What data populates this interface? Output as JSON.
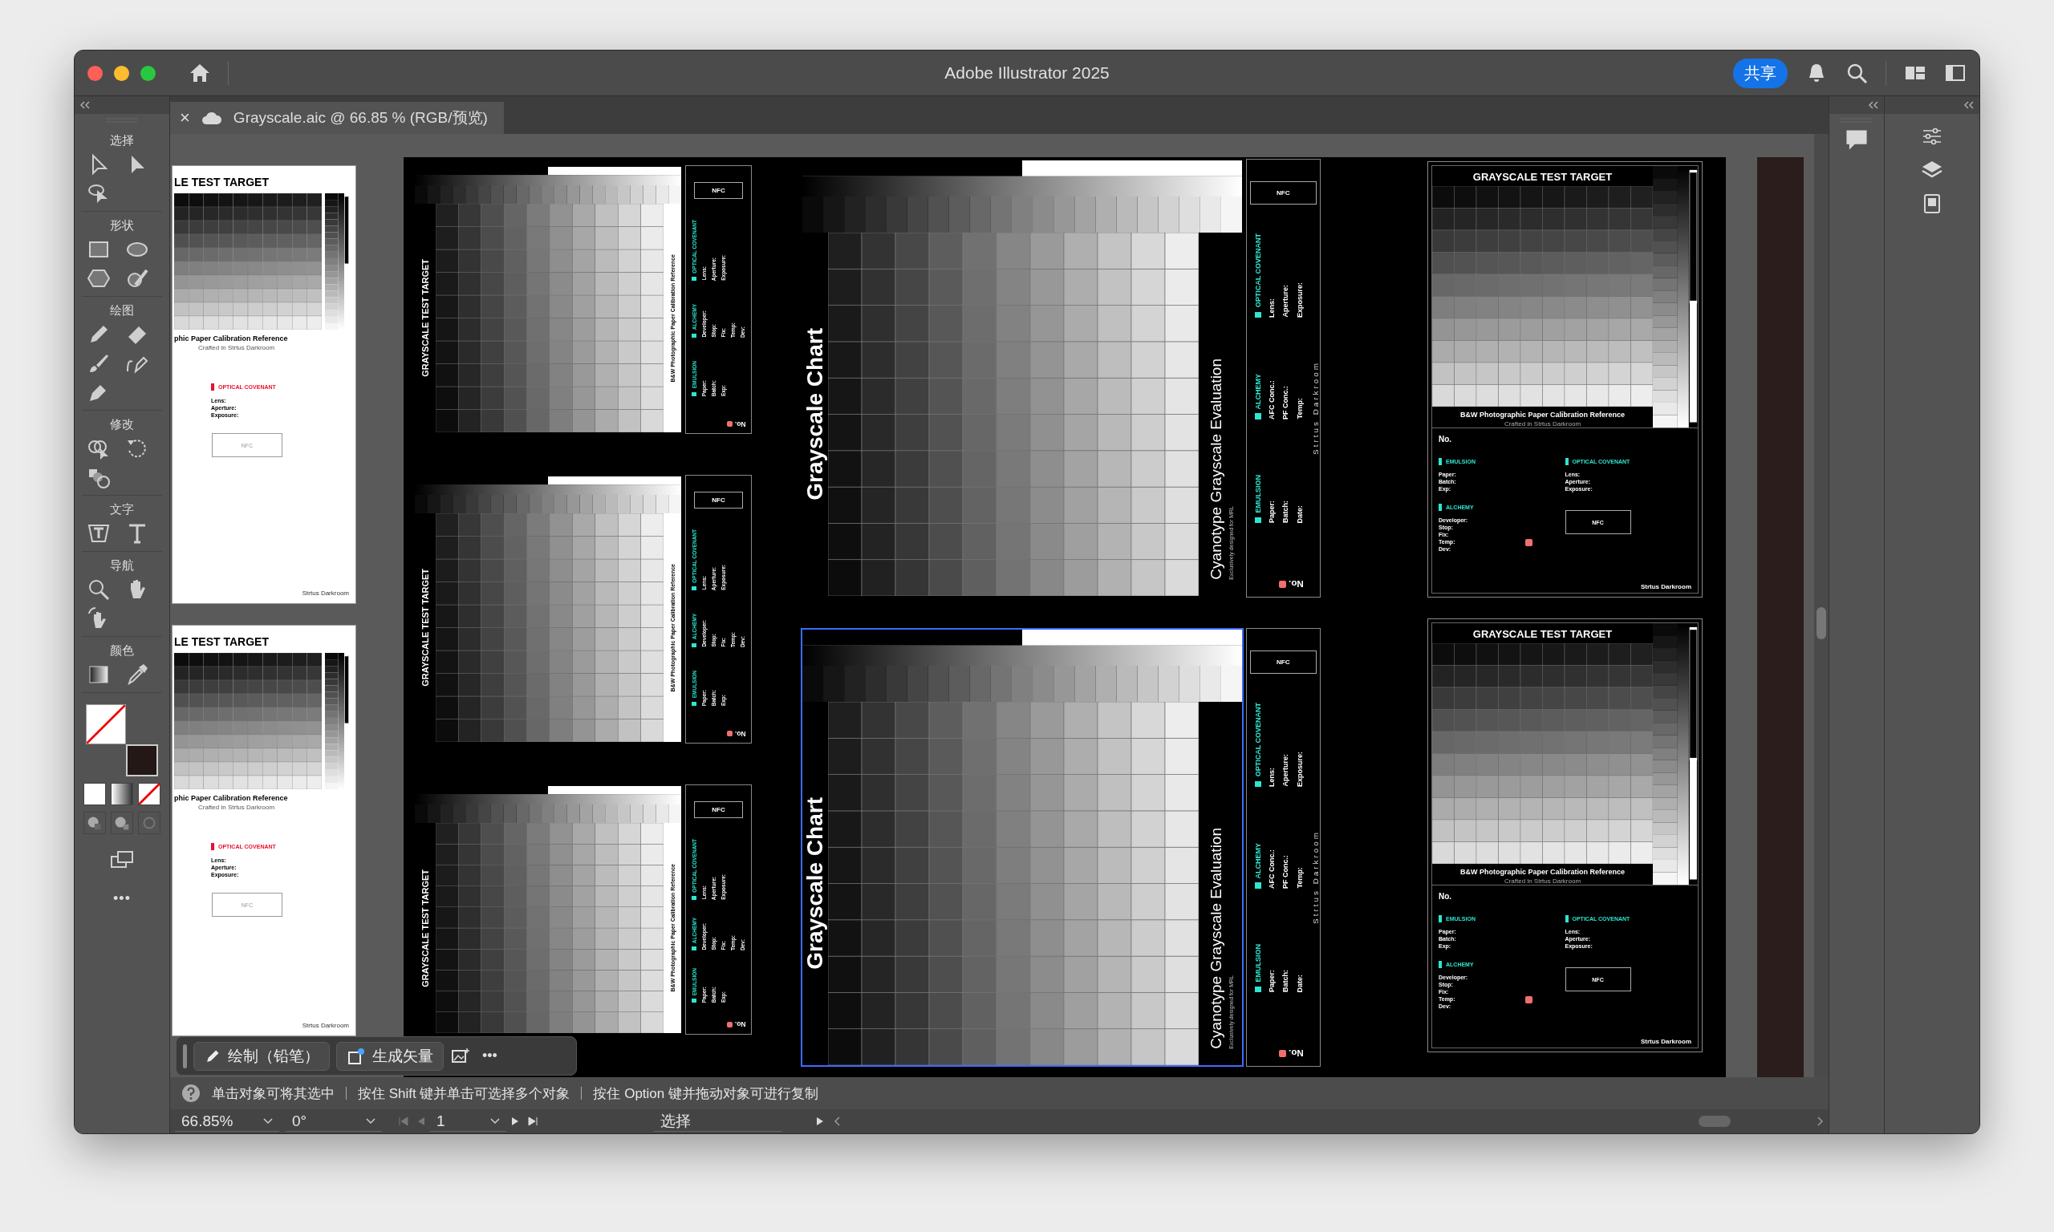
{
  "app": {
    "title": "Adobe Illustrator 2025",
    "share": "共享"
  },
  "document_tab": {
    "close": "×",
    "title": "Grayscale.aic @ 66.85 % (RGB/预览)"
  },
  "toolbar": {
    "groups": [
      {
        "label": "选择",
        "tools": [
          {
            "kind": "direct"
          },
          {
            "kind": "select"
          },
          {
            "kind": "lasso"
          }
        ]
      },
      {
        "label": "形状",
        "tools": [
          {
            "kind": "rect"
          },
          {
            "kind": "ellipse"
          },
          {
            "kind": "hexagon"
          },
          {
            "kind": "shaper"
          }
        ]
      },
      {
        "label": "绘图",
        "tools": [
          {
            "kind": "pencil"
          },
          {
            "kind": "eraser"
          },
          {
            "kind": "brush"
          },
          {
            "kind": "curvature"
          },
          {
            "kind": "pen"
          }
        ]
      },
      {
        "label": "修改",
        "tools": [
          {
            "kind": "builder"
          },
          {
            "kind": "rotate"
          },
          {
            "kind": "blend"
          }
        ]
      },
      {
        "label": "文字",
        "tools": [
          {
            "kind": "touchtype"
          },
          {
            "kind": "type"
          }
        ]
      },
      {
        "label": "导航",
        "tools": [
          {
            "kind": "zoom"
          },
          {
            "kind": "hand"
          },
          {
            "kind": "rotateview"
          }
        ]
      },
      {
        "label": "颜色",
        "tools": [
          {
            "kind": "gradient"
          },
          {
            "kind": "eyedropper"
          }
        ]
      }
    ],
    "more": "•••"
  },
  "canvas": {
    "page_boards": [
      {
        "title": "LE TEST TARGET",
        "subtitle": "phic Paper Calibration Reference",
        "credit_line": "Crafted in Strtus Darkroom",
        "section": "OPTICAL COVENANT",
        "fields": [
          "Lens:",
          "Aperture:",
          "Exposure:"
        ],
        "nfc": "NFC",
        "credit": "Strtus Darkroom"
      },
      {
        "title": "LE TEST TARGET",
        "subtitle": "phic Paper Calibration Reference",
        "credit_line": "Crafted in Strtus Darkroom",
        "section": "OPTICAL COVENANT",
        "fields": [
          "Lens:",
          "Aperture:",
          "Exposure:"
        ],
        "nfc": "NFC",
        "credit": "Strtus Darkroom"
      }
    ],
    "strip_boards": [
      {
        "title": "GRAYSCALE TEST TARGET",
        "subtitle": "B&W Photographic Paper Calibration Reference",
        "panel": {
          "nfc": "NFC",
          "sections": [
            {
              "name": "OPTICAL COVENANT",
              "fields": [
                "Lens:",
                "Aperture:",
                "Exposure:"
              ]
            },
            {
              "name": "ALCHEMY",
              "fields": [
                "Developer:",
                "Stop:",
                "Fix:",
                "Temp:",
                "Dev:"
              ]
            },
            {
              "name": "EMULSION",
              "fields": [
                "Paper:",
                "Batch:",
                "Exp:"
              ]
            }
          ],
          "number": "No."
        }
      },
      {
        "title": "GRAYSCALE TEST TARGET",
        "subtitle": "B&W Photographic Paper Calibration Reference",
        "panel": {
          "nfc": "NFC",
          "sections": [
            {
              "name": "OPTICAL COVENANT",
              "fields": [
                "Lens:",
                "Aperture:",
                "Exposure:"
              ]
            },
            {
              "name": "ALCHEMY",
              "fields": [
                "Developer:",
                "Stop:",
                "Fix:",
                "Temp:",
                "Dev:"
              ]
            },
            {
              "name": "EMULSION",
              "fields": [
                "Paper:",
                "Batch:",
                "Exp:"
              ]
            }
          ],
          "number": "No."
        }
      },
      {
        "title": "GRAYSCALE TEST TARGET",
        "subtitle": "B&W Photographic Paper Calibration Reference",
        "panel": {
          "nfc": "NFC",
          "sections": [
            {
              "name": "OPTICAL COVENANT",
              "fields": [
                "Lens:",
                "Aperture:",
                "Exposure:"
              ]
            },
            {
              "name": "ALCHEMY",
              "fields": [
                "Developer:",
                "Stop:",
                "Fix:",
                "Temp:",
                "Dev:"
              ]
            },
            {
              "name": "EMULSION",
              "fields": [
                "Paper:",
                "Batch:",
                "Exp:"
              ]
            }
          ],
          "number": "No."
        }
      }
    ],
    "chart_boards": [
      {
        "title": "Grayscale Chart",
        "subtitle": "Cyanotype Grayscale Evaluation",
        "tagline": "Exclusively designed for MRL",
        "selected": false,
        "panel": {
          "nfc": "NFC",
          "sections": [
            {
              "name": "OPTICAL COVENANT",
              "fields": [
                "Lens:",
                "Aperture:",
                "Exposure:"
              ]
            },
            {
              "name": "ALCHEMY",
              "fields": [
                "AFC Conc.:",
                "PF Conc.:",
                "Temp:"
              ]
            },
            {
              "name": "EMULSION",
              "fields": [
                "Paper:",
                "Batch:",
                "Date:"
              ]
            }
          ],
          "credit": "Strtus Darkroom",
          "number": "No."
        }
      },
      {
        "title": "Grayscale Chart",
        "subtitle": "Cyanotype Grayscale Evaluation",
        "tagline": "Exclusively designed for MRL",
        "selected": true,
        "panel": {
          "nfc": "NFC",
          "sections": [
            {
              "name": "OPTICAL COVENANT",
              "fields": [
                "Lens:",
                "Aperture:",
                "Exposure:"
              ]
            },
            {
              "name": "ALCHEMY",
              "fields": [
                "AFC Conc.:",
                "PF Conc.:",
                "Temp:"
              ]
            },
            {
              "name": "EMULSION",
              "fields": [
                "Paper:",
                "Batch:",
                "Date:"
              ]
            }
          ],
          "credit": "Strtus Darkroom",
          "number": "No."
        }
      }
    ],
    "target_boards": [
      {
        "title": "GRAYSCALE TEST TARGET",
        "subtitle": "B&W Photographic Paper Calibration Reference",
        "credit_line": "Crafted in Strtus Darkroom",
        "number": "No.",
        "sections": [
          {
            "name": "EMULSION",
            "fields": [
              "Paper:",
              "Batch:",
              "Exp:"
            ]
          },
          {
            "name": "ALCHEMY",
            "fields": [
              "Developer:",
              "Stop:",
              "Fix:",
              "Temp:",
              "Dev:"
            ]
          },
          {
            "name": "OPTICAL COVENANT",
            "fields": [
              "Lens:",
              "Aperture:",
              "Exposure:"
            ]
          }
        ],
        "nfc": "NFC",
        "credit": "Strtus Darkroom"
      },
      {
        "title": "GRAYSCALE TEST TARGET",
        "subtitle": "B&W Photographic Paper Calibration Reference",
        "credit_line": "Crafted in Strtus Darkroom",
        "number": "No.",
        "sections": [
          {
            "name": "EMULSION",
            "fields": [
              "Paper:",
              "Batch:",
              "Exp:"
            ]
          },
          {
            "name": "ALCHEMY",
            "fields": [
              "Developer:",
              "Stop:",
              "Fix:",
              "Temp:",
              "Dev:"
            ]
          },
          {
            "name": "OPTICAL COVENANT",
            "fields": [
              "Lens:",
              "Aperture:",
              "Exposure:"
            ]
          }
        ],
        "nfc": "NFC",
        "credit": "Strtus Darkroom"
      }
    ]
  },
  "context_bar": {
    "draw": "绘制（铅笔）",
    "vectorize": "生成矢量",
    "more": "•••"
  },
  "hints": [
    "单击对象可将其选中",
    "按住 Shift 键并单击可选择多个对象",
    "按住 Option 键并拖动对象可进行复制"
  ],
  "status": {
    "zoom": "66.85%",
    "rotation": "0°",
    "artboard": "1",
    "tool": "选择"
  }
}
